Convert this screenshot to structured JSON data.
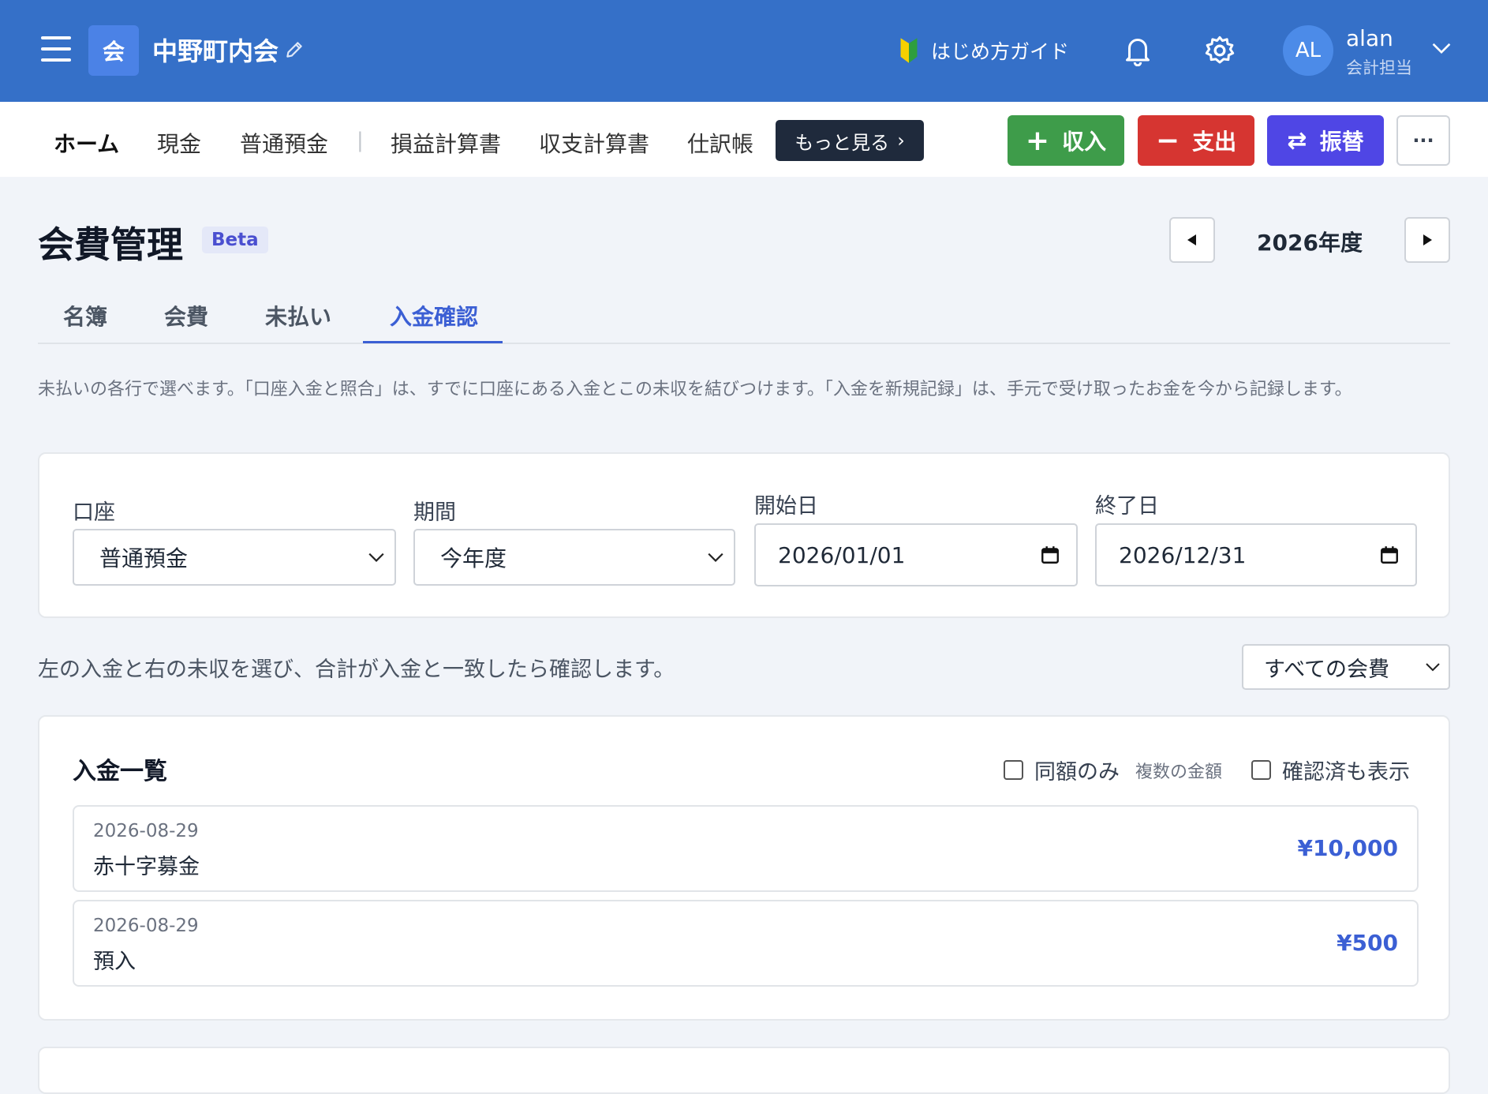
{
  "header": {
    "org_badge": "会",
    "org_name": "中野町内会",
    "guide_label": "はじめ方ガイド",
    "user": {
      "initials": "AL",
      "name": "alan",
      "role": "会計担当"
    }
  },
  "nav": {
    "items": [
      {
        "label": "ホーム",
        "active": true
      },
      {
        "label": "現金"
      },
      {
        "label": "普通預金"
      },
      {
        "label": "損益計算書"
      },
      {
        "label": "収支計算書"
      },
      {
        "label": "仕訳帳"
      }
    ],
    "separator": "|",
    "more_label": "もっと見る",
    "more_glyph": "›",
    "actions": {
      "income": {
        "label": "収入",
        "glyph": "+"
      },
      "expense": {
        "label": "支出",
        "glyph": "−"
      },
      "transfer": {
        "label": "振替",
        "glyph": "⇄"
      },
      "overflow": "···"
    }
  },
  "page": {
    "title": "会費管理",
    "badge": "Beta",
    "year_label": "2026年度",
    "tabs": [
      {
        "label": "名簿"
      },
      {
        "label": "会費"
      },
      {
        "label": "未払い"
      },
      {
        "label": "入金確認",
        "active": true
      }
    ],
    "help_text": "未払いの各行で選べます。「口座入金と照合」は、すでに口座にある入金とこの未収を結びつけます。「入金を新規記録」は、手元で受け取ったお金を今から記録します。"
  },
  "filters": {
    "account": {
      "label": "口座",
      "value": "普通預金"
    },
    "period": {
      "label": "期間",
      "value": "今年度"
    },
    "start_date": {
      "label": "開始日",
      "value": "2026/01/01"
    },
    "end_date": {
      "label": "終了日",
      "value": "2026/12/31"
    }
  },
  "instruction": "左の入金と右の未収を選び、合計が入金と一致したら確認します。",
  "fee_filter": {
    "value": "すべての会費"
  },
  "deposits": {
    "title": "入金一覧",
    "same_amount": {
      "label": "同額のみ",
      "note": "複数の金額",
      "checked": false
    },
    "show_confirmed": {
      "label": "確認済も表示",
      "checked": false
    },
    "rows": [
      {
        "date": "2026-08-29",
        "description": "赤十字募金",
        "amount": "¥10,000"
      },
      {
        "date": "2026-08-29",
        "description": "預入",
        "amount": "¥500"
      }
    ]
  },
  "colors": {
    "topbar": "#3570c8",
    "income": "#3e9c4a",
    "expense": "#d63531",
    "transfer": "#4f46e5",
    "accent": "#3b5fd4"
  }
}
